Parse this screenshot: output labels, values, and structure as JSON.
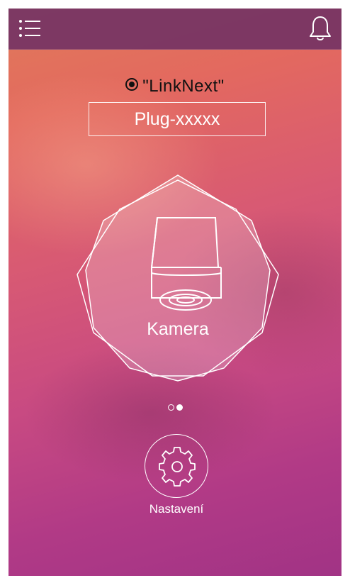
{
  "topbar": {
    "menu_icon": "list-menu-icon",
    "notifications_icon": "bell-icon"
  },
  "network": {
    "indicator_icon": "radio-selected-icon",
    "label": "\"LinkNext\""
  },
  "device_name": {
    "value": "Plug-xxxxx"
  },
  "device_card": {
    "icon": "camera-icon",
    "label": "Kamera"
  },
  "pager": {
    "page_count": 2,
    "active_page": 2
  },
  "settings": {
    "icon": "gear-icon",
    "label": "Nastavení"
  }
}
